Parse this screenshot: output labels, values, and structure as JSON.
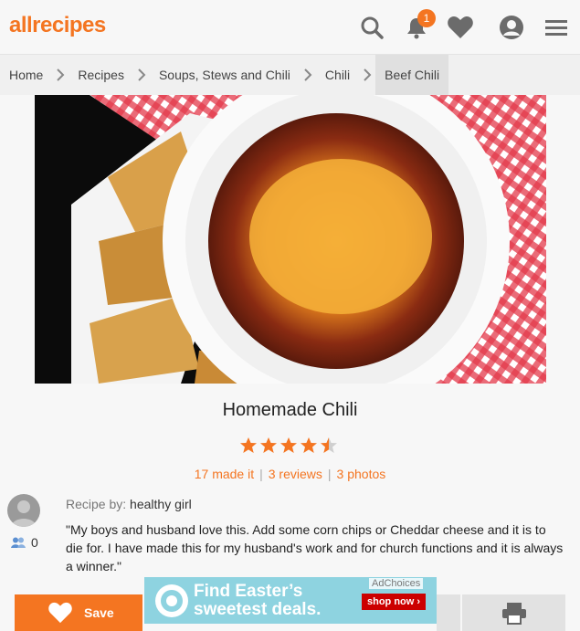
{
  "header": {
    "logo": "allrecipes",
    "notification_count": "1",
    "icons": [
      "search-icon",
      "bell-icon",
      "heart-icon",
      "profile-icon",
      "menu-icon"
    ]
  },
  "breadcrumb": [
    "Home",
    "Recipes",
    "Soups, Stews and Chili",
    "Chili",
    "Beef Chili"
  ],
  "recipe": {
    "title": "Homemade Chili",
    "rating": 4.5,
    "made_it": "17 made it",
    "reviews": "3 reviews",
    "photos": "3 photos",
    "recipe_by_label": "Recipe by:",
    "author": "healthy girl",
    "made_count": "0",
    "description": "\"My boys and husband love this. Add some corn chips or Cheddar cheese and it is to die for. I have made this for my husband's work and for church functions and it is always a winner.\""
  },
  "actions": {
    "save_label": "Save"
  },
  "ad": {
    "line1": "Find Easter’s",
    "line2": "sweetest deals.",
    "cta": "shop now ›",
    "adchoices": "AdChoices"
  },
  "colors": {
    "accent": "#f47521",
    "background": "#f7f7f7",
    "ad_background": "#8ed3e0"
  }
}
